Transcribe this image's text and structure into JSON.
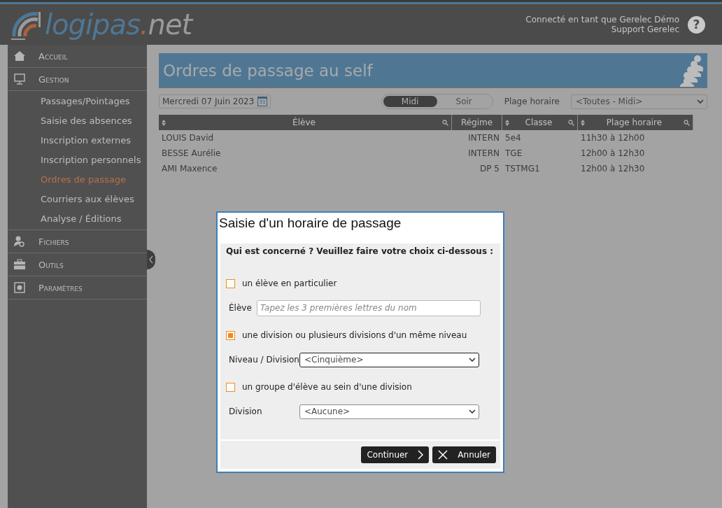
{
  "logo": {
    "name": "logipas",
    "dot": ".",
    "tld": "net"
  },
  "user": {
    "line1": "Connecté en tant que Gerelec Démo",
    "line2": "Support Gerelec",
    "help": "?"
  },
  "sidebar": {
    "items": [
      {
        "label": "Accueil"
      },
      {
        "label": "Gestion",
        "children": [
          {
            "label": "Passages/Pointages",
            "selected": false
          },
          {
            "label": "Saisie des absences",
            "selected": false
          },
          {
            "label": "Inscription externes",
            "selected": false
          },
          {
            "label": "Inscription personnels",
            "selected": false
          },
          {
            "label": "Ordres de passage",
            "selected": true
          },
          {
            "label": "Courriers aux élèves",
            "selected": false
          },
          {
            "label": "Analyse / Éditions",
            "selected": false
          }
        ]
      },
      {
        "label": "Fichiers"
      },
      {
        "label": "Outils"
      },
      {
        "label": "Paramètres"
      }
    ]
  },
  "page": {
    "title": "Ordres de passage au self",
    "date": "Mercredi 07 Juin 2023",
    "calendar_day": "31",
    "toggle": [
      {
        "label": "Midi",
        "selected": true
      },
      {
        "label": "Soir",
        "selected": false
      }
    ],
    "time_slot_label": "Plage horaire",
    "time_slot_value": "<Toutes - Midi>"
  },
  "table": {
    "columns": [
      {
        "label": "Élève",
        "kind": "searchable"
      },
      {
        "label": "Régime",
        "kind": "plain"
      },
      {
        "label": "Classe",
        "kind": "searchable"
      },
      {
        "label": "Plage horaire",
        "kind": "searchable"
      }
    ],
    "rows": [
      [
        "LOUIS David",
        "INTERN",
        "5e4",
        "11h30 à 12h00"
      ],
      [
        "BESSE Aurélie",
        "INTERN",
        "TGE",
        "12h00 à 12h30"
      ],
      [
        "AMI Maxence",
        "DP 5",
        "TSTMG1",
        "12h00 à 12h30"
      ]
    ]
  },
  "dialog": {
    "title": "Saisie d'un horaire de passage",
    "question": "Qui est concerné ? Veuillez faire votre choix ci-dessous :",
    "options": [
      {
        "label": "un élève en particulier",
        "checked": false,
        "field_label": "Élève",
        "kind": "input",
        "placeholder": "Tapez les 3 premières lettres du nom"
      },
      {
        "label": "une division ou plusieurs divisions d'un même niveau",
        "checked": true,
        "field_label": "Niveau / Division",
        "kind": "select",
        "value": "<Cinquième>"
      },
      {
        "label": "un groupe d'élève au sein d'une division",
        "checked": false,
        "field_label": "Division",
        "kind": "select",
        "value": "<Aucune>"
      }
    ],
    "buttons": [
      {
        "label": "Continuer",
        "kind": "next"
      },
      {
        "label": "Annuler",
        "kind": "cancel"
      }
    ]
  }
}
